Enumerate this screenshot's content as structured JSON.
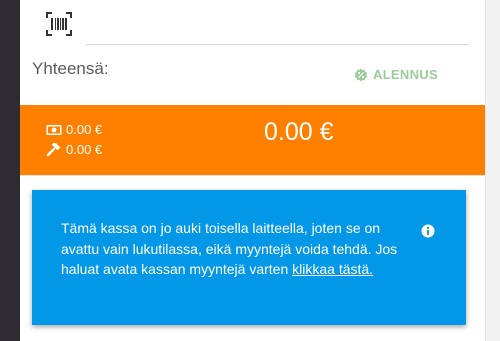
{
  "search": {
    "value": "",
    "placeholder": ""
  },
  "total_label": "Yhteensä:",
  "discount": {
    "label": "ALENNUS",
    "icon": "badge-percent-icon",
    "color": "#9ccc9a"
  },
  "totals": {
    "cash_amount": "0.00 €",
    "card_amount": "0.00 €",
    "grand_total": "0.00 €",
    "bar_color": "#ff8000"
  },
  "notice": {
    "text": "Tämä kassa on jo auki toisella laitteella, joten se on avattu vain lukutilassa, eikä myyntejä voida tehdä. Jos haluat avata kassan myyntejä varten ",
    "link": "klikkaa tästä.",
    "color": "#0397e8",
    "icon": "info-icon"
  }
}
